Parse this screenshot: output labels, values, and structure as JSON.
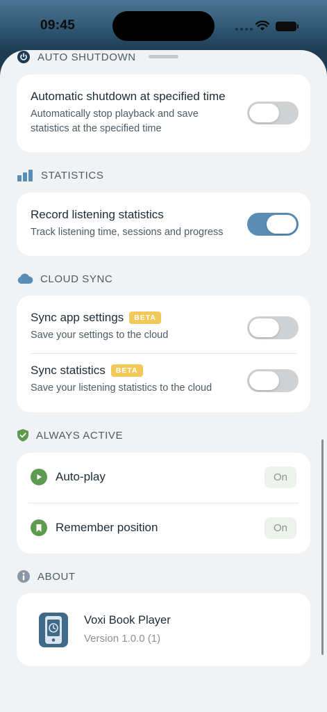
{
  "status_bar": {
    "time": "09:45"
  },
  "sections": {
    "auto_shutdown": {
      "header": "AUTO SHUTDOWN",
      "row": {
        "title": "Automatic shutdown at specified time",
        "subtitle": "Automatically stop playback and save statistics at the specified time",
        "enabled": false
      }
    },
    "statistics": {
      "header": "STATISTICS",
      "row": {
        "title": "Record listening statistics",
        "subtitle": "Track listening time, sessions and progress",
        "enabled": true
      }
    },
    "cloud_sync": {
      "header": "CLOUD SYNC",
      "rows": [
        {
          "title": "Sync app settings",
          "badge": "BETA",
          "subtitle": "Save your settings to the cloud",
          "enabled": false
        },
        {
          "title": "Sync statistics",
          "badge": "BETA",
          "subtitle": "Save your listening statistics to the cloud",
          "enabled": false
        }
      ]
    },
    "always_active": {
      "header": "ALWAYS ACTIVE",
      "rows": [
        {
          "label": "Auto-play",
          "status": "On",
          "icon": "play-icon"
        },
        {
          "label": "Remember position",
          "status": "On",
          "icon": "bookmark-icon"
        }
      ]
    },
    "about": {
      "header": "ABOUT",
      "app_name": "Voxi Book Player",
      "version": "Version 1.0.0 (1)"
    }
  },
  "colors": {
    "accent": "#5a8db5",
    "green": "#5e9a50",
    "beta": "#f1c95b",
    "background": "#f0f2f4"
  }
}
